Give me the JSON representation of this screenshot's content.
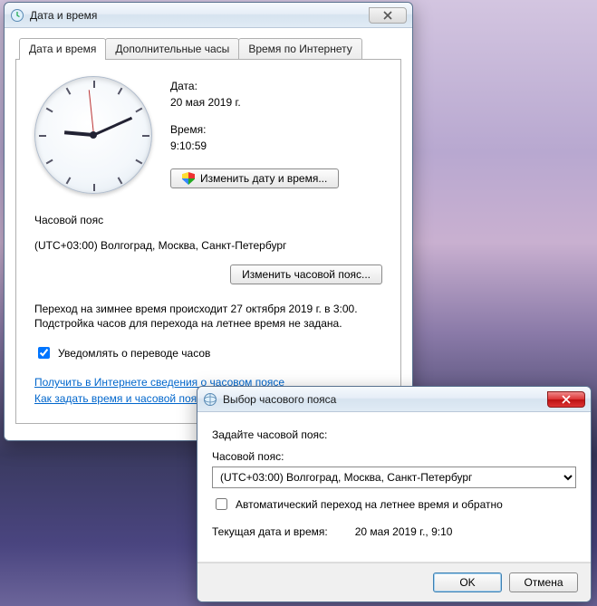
{
  "win1": {
    "title": "Дата и время",
    "tabs": [
      "Дата и время",
      "Дополнительные часы",
      "Время по Интернету"
    ],
    "date_label": "Дата:",
    "date_value": "20 мая 2019 г.",
    "time_label": "Время:",
    "time_value": "9:10:59",
    "change_datetime_btn": "Изменить дату и время...",
    "tz_heading": "Часовой пояс",
    "tz_value": "(UTC+03:00) Волгоград, Москва, Санкт-Петербург",
    "change_tz_btn": "Изменить часовой пояс...",
    "dst_line1": "Переход на зимнее время происходит 27 октября 2019 г. в 3:00.",
    "dst_line2": "Подстройка часов для перехода на летнее время не задана.",
    "notify_label": "Уведомлять о переводе часов",
    "notify_checked": true,
    "link1": "Получить в Интернете сведения о часовом поясе",
    "link2": "Как задать время и часовой пояс?"
  },
  "win2": {
    "title": "Выбор часового пояса",
    "prompt": "Задайте часовой пояс:",
    "tz_label": "Часовой пояс:",
    "tz_selected": "(UTC+03:00) Волгоград, Москва, Санкт-Петербург",
    "auto_dst_label": "Автоматический переход на летнее время и обратно",
    "auto_dst_checked": false,
    "now_label": "Текущая дата и время:",
    "now_value": "20 мая 2019 г., 9:10",
    "ok": "OK",
    "cancel": "Отмена"
  }
}
